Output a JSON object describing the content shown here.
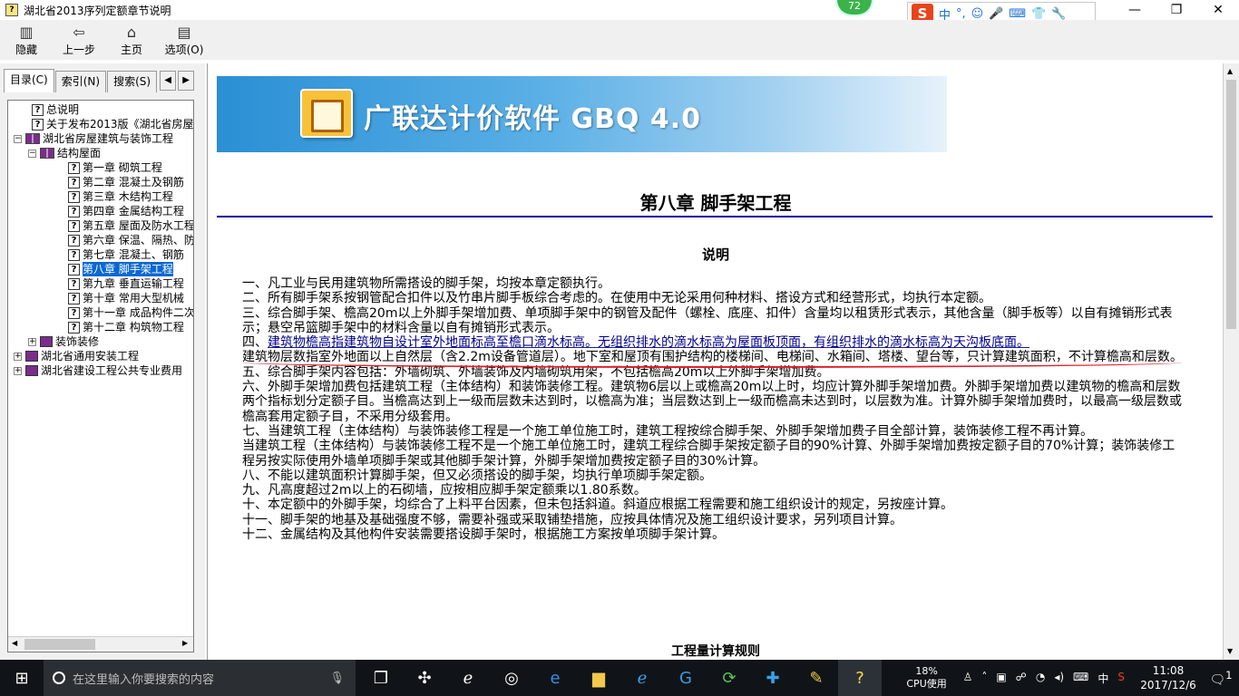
{
  "window": {
    "title": "湖北省2013序列定额章节说明",
    "badge": "72",
    "controls": {
      "minimize": "—",
      "restore": "❐",
      "close": "✕"
    }
  },
  "ime": {
    "logo": "S",
    "mode": "中",
    "icons": [
      "°,",
      "☺",
      "🎤",
      "⌨",
      "👕",
      "🔧"
    ]
  },
  "toolbar": [
    {
      "id": "hide",
      "label": "隐藏",
      "icon": "hide-icon"
    },
    {
      "id": "back",
      "label": "上一步",
      "icon": "back-arrow-icon"
    },
    {
      "id": "home",
      "label": "主页",
      "icon": "home-icon"
    },
    {
      "id": "options",
      "label": "选项(O)",
      "icon": "options-icon"
    }
  ],
  "tabs": [
    {
      "label": "目录(C)",
      "active": true
    },
    {
      "label": "索引(N)",
      "active": false
    },
    {
      "label": "搜索(S)",
      "active": false
    }
  ],
  "tree": [
    {
      "label": "总说明",
      "level": 1,
      "type": "topic"
    },
    {
      "label": "关于发布2013版《湖北省房屋",
      "level": 1,
      "type": "topic"
    },
    {
      "label": "湖北省房屋建筑与装饰工程",
      "level": 0,
      "type": "book-open",
      "expander": "⊟"
    },
    {
      "label": "结构屋面",
      "level": 1,
      "type": "book-open",
      "expander": "⊟"
    },
    {
      "label": "第一章  砌筑工程",
      "level": 2,
      "type": "topic"
    },
    {
      "label": "第二章  混凝土及钢筋",
      "level": 2,
      "type": "topic"
    },
    {
      "label": "第三章  木结构工程",
      "level": 2,
      "type": "topic"
    },
    {
      "label": "第四章  金属结构工程",
      "level": 2,
      "type": "topic"
    },
    {
      "label": "第五章  屋面及防水工程",
      "level": 2,
      "type": "topic"
    },
    {
      "label": "第六章  保温、隔热、防",
      "level": 2,
      "type": "topic"
    },
    {
      "label": "第七章  混凝土、钢筋",
      "level": 2,
      "type": "topic"
    },
    {
      "label": "第八章  脚手架工程",
      "level": 2,
      "type": "topic",
      "selected": true
    },
    {
      "label": "第九章  垂直运输工程",
      "level": 2,
      "type": "topic"
    },
    {
      "label": "第十章  常用大型机械",
      "level": 2,
      "type": "topic"
    },
    {
      "label": "第十一章  成品构件二次",
      "level": 2,
      "type": "topic"
    },
    {
      "label": "第十二章  构筑物工程",
      "level": 2,
      "type": "topic"
    },
    {
      "label": "装饰装修",
      "level": 1,
      "type": "book-closed",
      "expander": "⊞"
    },
    {
      "label": "湖北省通用安装工程",
      "level": 0,
      "type": "book-closed",
      "expander": "⊞"
    },
    {
      "label": "湖北省建设工程公共专业费用",
      "level": 0,
      "type": "book-closed",
      "expander": "⊞"
    }
  ],
  "content": {
    "banner_title": "广联达计价软件 GBQ 4.0",
    "chapter_title": "第八章  脚手架工程",
    "section_title": "说明",
    "paragraphs": [
      "一、凡工业与民用建筑物所需搭设的脚手架，均按本章定额执行。",
      "二、所有脚手架系按钢管配合扣件以及竹串片脚手板综合考虑的。在使用中无论采用何种材料、搭设方式和经营形式，均执行本定额。",
      "三、综合脚手架、檐高20m以上外脚手架增加费、单项脚手架中的钢管及配件（螺栓、底座、扣件）含量均以租赁形式表示，其他含量（脚手板等）以自有摊销形式表示；悬空吊篮脚手架中的材料含量以自有摊销形式表示。",
      "__P4__",
      "建筑物层数指室外地面以上自然层（含2.2m设备管道层）。地下室和屋顶有围护结构的楼梯间、电梯间、水箱间、塔楼、望台等，只计算建筑面积，不计算檐高和层数。",
      "五、综合脚手架内容包括：外墙砌筑、外墙装饰及内墙砌筑用架，不包括檐高20m以上外脚手架增加费。",
      "六、外脚手架增加费包括建筑工程（主体结构）和装饰装修工程。建筑物6层以上或檐高20m以上时，均应计算外脚手架增加费。外脚手架增加费以建筑物的檐高和层数两个指标划分定额子目。当檐高达到上一级而层数未达到时，以檐高为准；当层数达到上一级而檐高未达到时，以层数为准。计算外脚手架增加费时，以最高一级层数或檐高套用定额子目，不采用分级套用。",
      "七、当建筑工程（主体结构）与装饰装修工程是一个施工单位施工时，建筑工程按综合脚手架、外脚手架增加费子目全部计算，装饰装修工程不再计算。",
      "当建筑工程（主体结构）与装饰装修工程不是一个施工单位施工时，建筑工程综合脚手架按定额子目的90%计算、外脚手架增加费按定额子目的70%计算；装饰装修工程另按实际使用外墙单项脚手架或其他脚手架计算，外脚手架增加费按定额子目的30%计算。",
      "八、不能以建筑面积计算脚手架，但又必须搭设的脚手架，均执行单项脚手架定额。",
      "九、凡高度超过2m以上的石砌墙，应按相应脚手架定额乘以1.80系数。",
      "十、本定额中的外脚手架，均综合了上料平台因素，但未包括斜道。斜道应根据工程需要和施工组织设计的规定，另按座计算。",
      "十一、脚手架的地基及基础强度不够，需要补强或采取铺垫措施，应按具体情况及施工组织设计要求，另列项目计算。",
      "十二、金属结构及其他构件安装需要搭设脚手架时，根据施工方案按单项脚手架计算。"
    ],
    "para4_prefix": "四、",
    "para4_underlined": "建筑物檐高指建筑物自设计室外地面标高至檐口滴水标高。无组织排水的滴水标高为屋面板顶面，有组织排水的滴水标高为天沟板底面。",
    "footer_heading": "工程量计算规则"
  },
  "taskbar": {
    "search_placeholder": "在这里输入你要搜索的内容",
    "cpu_percent": "18%",
    "cpu_label": "CPU使用",
    "ime_indicator": "中",
    "time": "11:08",
    "date": "2017/12/6",
    "notification_count": "1"
  },
  "colors": {
    "selection": "#0a68d2",
    "rule": "#0000a0",
    "annotation": "#e0202a",
    "taskbar": "#101418"
  }
}
